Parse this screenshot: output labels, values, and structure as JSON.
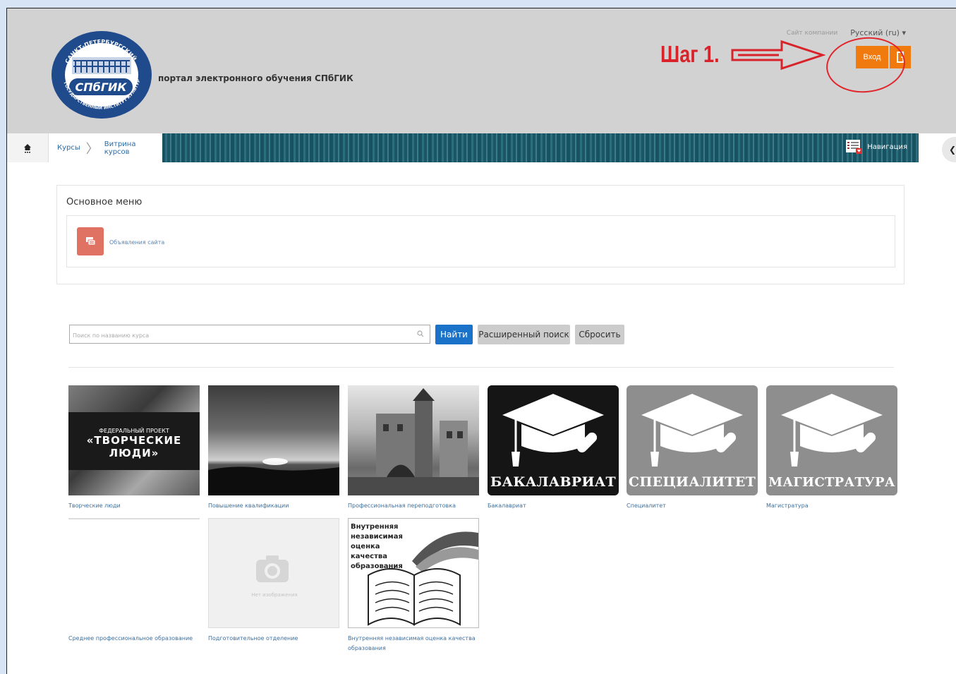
{
  "header": {
    "portal_title": "портал электронного обучения СПбГИК",
    "company_site": "Сайт компании",
    "language": "Русский (ru) ▾",
    "login_label": "Вход",
    "step_annotation": "Шаг 1."
  },
  "logo": {
    "text_top": "САНКТ-ПЕТЕРБУРГСКИЙ",
    "text_mid": "СПбГИК",
    "text_bottom": "ГОСУДАРСТВЕННЫЙ ИНСТИТУТ КУЛЬТУРЫ"
  },
  "breadcrumb": {
    "items": [
      "Курсы",
      "Витрина курсов"
    ]
  },
  "navigation_label": "Навигация",
  "main_menu": {
    "title": "Основное меню",
    "item_label": "Объявления сайта"
  },
  "search": {
    "placeholder": "Поиск по названию курса",
    "find_label": "Найти",
    "advanced_label": "Расширенный поиск",
    "reset_label": "Сбросить"
  },
  "courses": [
    {
      "caption": "Творческие люди",
      "image_text": [
        "ФЕДЕРАЛЬНЫЙ ПРОЕКТ",
        "«ТВОРЧЕСКИЕ",
        "ЛЮДИ»"
      ]
    },
    {
      "caption": "Повышение квалификации"
    },
    {
      "caption": "Профессиональная переподготовка"
    },
    {
      "caption": "Бакалавриат",
      "image_text": "БАКАЛАВРИАТ"
    },
    {
      "caption": "Специалитет",
      "image_text": "СПЕЦИАЛИТЕТ"
    },
    {
      "caption": "Магистратура",
      "image_text": "МАГИСТРАТУРА"
    },
    {
      "caption": "Среднее профессиональное образование"
    },
    {
      "caption": "Подготовительное отделение",
      "image_text": "Нет изображения"
    },
    {
      "caption": "Внутренняя независимая оценка качества образования",
      "image_text": [
        "Внутренняя",
        "независимая",
        "оценка",
        "качества",
        "образования"
      ]
    }
  ],
  "colors": {
    "login_orange": "#f07a0d",
    "annotation_red": "#d8232a",
    "find_blue": "#1a73c9",
    "nav_teal": "#1f5d6e",
    "header_gray": "#d2d2d2"
  }
}
